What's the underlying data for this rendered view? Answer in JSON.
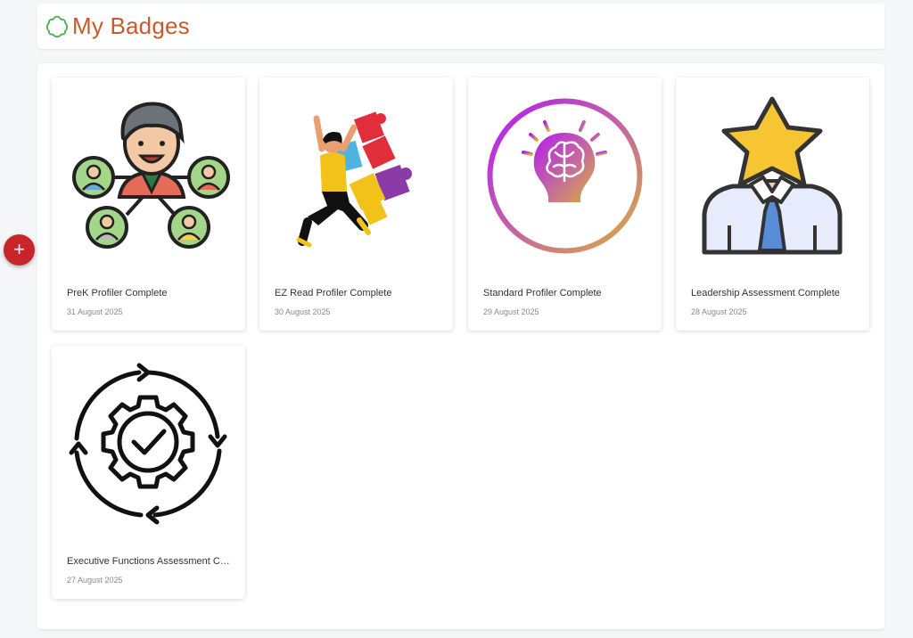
{
  "header": {
    "title": "My Badges",
    "logo_icon": "flower-outline-icon"
  },
  "fab": {
    "label": "+",
    "icon": "plus-icon"
  },
  "badges": [
    {
      "name": "PreK Profiler Complete",
      "date": "31 August 2025",
      "icon": "team-network-icon"
    },
    {
      "name": "EZ Read Profiler Complete",
      "date": "30 August 2025",
      "icon": "jumping-puzzle-icon"
    },
    {
      "name": "Standard Profiler Complete",
      "date": "29 August 2025",
      "icon": "lightbulb-brain-icon"
    },
    {
      "name": "Leadership Assessment Complete",
      "date": "28 August 2025",
      "icon": "star-head-person-icon"
    },
    {
      "name": "Executive Functions Assessment Co...",
      "date": "27 August 2025",
      "icon": "gear-check-icon"
    }
  ],
  "colors": {
    "title": "#c85a2e",
    "fab": "#c8252a",
    "logo": "#4caf50",
    "background": "#f5f6f8"
  }
}
